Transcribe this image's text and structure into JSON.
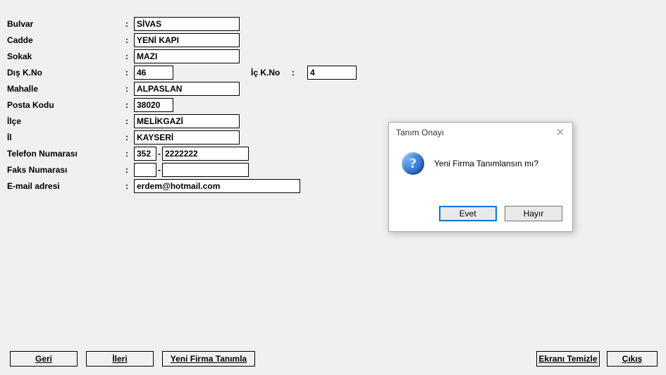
{
  "labels": {
    "bulvar": "Bulvar",
    "cadde": "Cadde",
    "sokak": "Sokak",
    "diskno": "Dış K.No",
    "ickno": "İç K.No",
    "mahalle": "Mahalle",
    "postakodu": "Posta Kodu",
    "ilce": "İlçe",
    "il": "İl",
    "telefon": "Telefon Numarası",
    "faks": "Faks Numarası",
    "email": "E-mail adresi",
    "colon": ":"
  },
  "values": {
    "bulvar": "SİVAS",
    "cadde": "YENİ KAPI",
    "sokak": "MAZI",
    "diskno": "46",
    "ickno": "4",
    "mahalle": "ALPASLAN",
    "postakodu": "38020",
    "ilce": "MELİKGAZİ",
    "il": "KAYSERİ",
    "tel_area": "352",
    "tel_num": "2222222",
    "fax_area": "",
    "fax_num": "",
    "email": "erdem@hotmail.com"
  },
  "buttons": {
    "geri": "Geri",
    "ileri": "İleri",
    "yeni": "Yeni Firma Tanımla",
    "temizle": "Ekranı Temizle",
    "cikis": "Çıkış"
  },
  "dialog": {
    "title": "Tanım Onayı",
    "message": "Yeni Firma Tanımlansın mı?",
    "evet": "Evet",
    "hayir": "Hayır",
    "qmark": "?"
  }
}
